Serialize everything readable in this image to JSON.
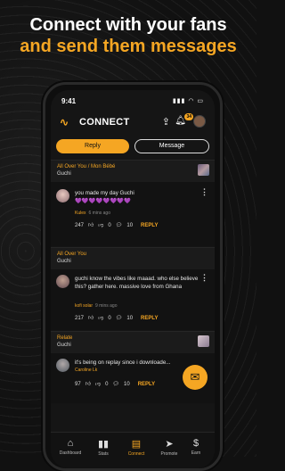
{
  "headline": {
    "line1": "Connect with your fans",
    "line2": "and send them messages"
  },
  "status": {
    "time": "9:41",
    "icons": "▮▮▮ ◠ ▭"
  },
  "appbar": {
    "title": "CONNECT",
    "badge": "34"
  },
  "tabs": {
    "reply": "Reply",
    "message": "Message"
  },
  "sections": [
    {
      "title": "All Over You / Mon Bébé",
      "artist": "Guchi",
      "comment": {
        "text": "you made my day Guchi",
        "hearts": "💜💜💜💜💜💜💜💜",
        "user": "Kulex",
        "ago": "6 mins ago",
        "likes": "247",
        "dislikes": "0",
        "replies": "10",
        "reply": "REPLY"
      }
    },
    {
      "title": "All Over You",
      "artist": "Guchi",
      "comment": {
        "text": "guchi know the vibes like maaad. who else believe this? gather here. massive love from Ghana",
        "user": "kofi solar",
        "ago": "9 mins ago",
        "likes": "217",
        "dislikes": "0",
        "replies": "10",
        "reply": "REPLY"
      }
    },
    {
      "title": "Relate",
      "artist": "Guchi",
      "comment": {
        "text": "it's being on replay since i downloade...",
        "user": "Caroline Lk",
        "ago": "",
        "likes": "97",
        "dislikes": "0",
        "replies": "10",
        "reply": "REPLY"
      }
    }
  ],
  "nav": [
    {
      "label": "Dashboard",
      "icon": "home-icon"
    },
    {
      "label": "Stats",
      "icon": "bar-chart-icon"
    },
    {
      "label": "Connect",
      "icon": "chat-icon"
    },
    {
      "label": "Promote",
      "icon": "send-icon"
    },
    {
      "label": "Earn",
      "icon": "dollar-icon"
    }
  ],
  "colors": {
    "accent": "#f5a623",
    "background": "#111111"
  }
}
